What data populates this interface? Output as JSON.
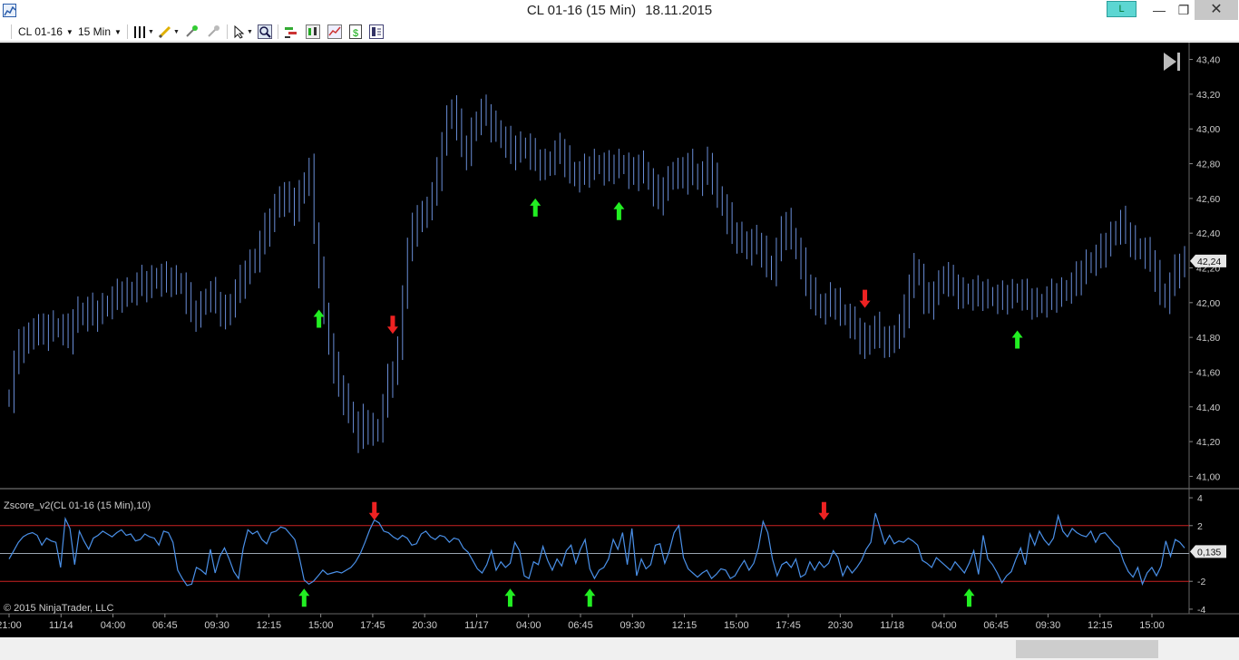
{
  "window": {
    "title": "CL 01-16 (15 Min)",
    "date": "18.11.2015",
    "badge": "L",
    "minimize": "—",
    "restore": "❐",
    "close": "✕"
  },
  "toolbar": {
    "instrument": "CL 01-16",
    "interval": "15 Min",
    "icons": [
      "bar-style-icon",
      "pencil-icon",
      "add-indicator-icon",
      "remove-indicator-icon",
      "cursor-icon",
      "zoom-icon",
      "strategy-icon",
      "candlestick-icon",
      "chart-style-icon",
      "dollar-icon",
      "properties-icon"
    ]
  },
  "colors": {
    "background": "#000000",
    "bars": "#6a8ed8",
    "indicator": "#4a90e8",
    "upper_band": "#cc2222",
    "lower_band": "#cc2222",
    "zero_line": "#9aa4b0",
    "axis_text": "#cccccc",
    "buy_arrow": "#22ee22",
    "sell_arrow": "#ee2222"
  },
  "chart_data": [
    {
      "type": "bar",
      "series": [
        {
          "values": [
            41.45,
            41.65,
            41.75,
            41.8,
            41.78,
            41.86,
            41.84,
            41.82,
            41.87,
            41.85,
            41.86,
            41.84,
            41.8,
            41.9,
            41.95,
            41.92,
            41.96,
            41.93,
            41.95,
            41.97,
            41.99,
            42.02,
            42.04,
            42.06,
            42.05,
            42.07,
            42.1,
            42.12,
            42.1,
            42.13,
            42.15,
            42.12,
            42.14,
            42.13,
            42.12,
            42.1,
            42.02,
            41.95,
            41.93,
            41.98,
            42.03,
            42.05,
            42.0,
            41.96,
            41.92,
            42.0,
            42.06,
            42.12,
            42.18,
            42.22,
            42.26,
            42.34,
            42.42,
            42.48,
            42.54,
            42.62,
            42.58,
            42.6,
            42.54,
            42.62,
            42.7,
            42.76,
            42.4,
            42.18,
            41.95,
            41.75,
            41.62,
            41.52,
            41.45,
            41.38,
            41.3,
            41.22,
            41.32,
            41.28,
            41.25,
            41.28,
            41.4,
            41.55,
            41.6,
            41.72,
            42.05,
            42.3,
            42.42,
            42.5,
            42.48,
            42.56,
            42.62,
            42.74,
            42.92,
            43.05,
            43.12,
            43.02,
            42.9,
            42.86,
            42.98,
            43.05,
            43.1,
            43.08,
            43.02,
            43.0,
            42.94,
            42.92,
            42.86,
            42.9,
            42.88,
            42.9,
            42.85,
            42.82,
            42.8,
            42.78,
            42.82,
            42.86,
            42.88,
            42.82,
            42.76,
            42.72,
            42.74,
            42.76,
            42.78,
            42.8,
            42.79,
            42.76,
            42.78,
            42.79,
            42.8,
            42.79,
            42.74,
            42.74,
            42.79,
            42.76,
            42.7,
            42.64,
            42.6,
            42.66,
            42.7,
            42.76,
            42.74,
            42.72,
            42.8,
            42.75,
            42.7,
            42.74,
            42.8,
            42.72,
            42.62,
            42.55,
            42.48,
            42.4,
            42.38,
            42.36,
            42.3,
            42.35,
            42.34,
            42.3,
            42.22,
            42.18,
            42.3,
            42.4,
            42.46,
            42.38,
            42.3,
            42.22,
            42.1,
            42.06,
            42.0,
            41.96,
            41.98,
            42.02,
            42.0,
            41.94,
            41.92,
            41.88,
            41.85,
            41.8,
            41.75,
            41.82,
            41.85,
            41.8,
            41.78,
            41.76,
            41.82,
            41.86,
            41.95,
            42.1,
            42.2,
            42.15,
            42.02,
            42.0,
            42.06,
            42.1,
            42.16,
            42.12,
            42.1,
            42.06,
            42.04,
            42.06,
            42.04,
            42.06,
            42.05,
            42.04,
            42.03,
            42.02,
            42.03,
            42.04,
            42.05,
            42.06,
            42.04,
            42.02,
            42.0,
            41.99,
            42.0,
            42.02,
            42.04,
            42.05,
            42.06,
            42.08,
            42.1,
            42.14,
            42.18,
            42.22,
            42.24,
            42.26,
            42.3,
            42.34,
            42.38,
            42.42,
            42.46,
            42.4,
            42.36,
            42.32,
            42.3,
            42.28,
            42.24,
            42.16,
            42.06,
            42.02,
            42.1,
            42.18,
            42.22,
            42.24
          ]
        }
      ],
      "ylim": [
        40.95,
        43.45
      ],
      "y_ticks": [
        "43,40",
        "43,20",
        "43,00",
        "42,80",
        "42,60",
        "42,40",
        "42,20",
        "42,00",
        "41,80",
        "41,60",
        "41,40",
        "41,20",
        "41,00"
      ],
      "last_price": "42,24",
      "x_ticks": [
        "21:00",
        "11/14",
        "04:00",
        "06:45",
        "09:30",
        "12:15",
        "15:00",
        "17:45",
        "20:30",
        "11/17",
        "04:00",
        "06:45",
        "09:30",
        "12:15",
        "15:00",
        "17:45",
        "20:30",
        "11/18",
        "04:00",
        "06:45",
        "09:30",
        "12:15",
        "15:00"
      ],
      "signals": [
        {
          "type": "buy",
          "bar": 63
        },
        {
          "type": "sell",
          "bar": 78
        },
        {
          "type": "buy",
          "bar": 107
        },
        {
          "type": "buy",
          "bar": 124
        },
        {
          "type": "sell",
          "bar": 174
        },
        {
          "type": "buy",
          "bar": 205
        }
      ]
    },
    {
      "type": "line",
      "title": "Zscore_v2(CL 01-16 (15 Min),10)",
      "series": [
        {
          "values": [
            -0.4,
            0.2,
            0.8,
            1.2,
            1.4,
            1.5,
            1.3,
            0.6,
            1.1,
            0.9,
            0.8,
            -1.0,
            2.5,
            1.8,
            -0.8,
            1.6,
            0.9,
            0.3,
            1.1,
            1.3,
            1.6,
            1.4,
            1.2,
            1.5,
            1.7,
            1.3,
            1.4,
            0.9,
            1.0,
            1.4,
            1.2,
            1.1,
            0.6,
            1.6,
            1.5,
            0.8,
            -1.2,
            -1.8,
            -2.3,
            -2.2,
            -1.0,
            -1.2,
            -1.5,
            0.3,
            -1.4,
            -0.2,
            0.4,
            -0.4,
            -1.3,
            -1.8,
            0.4,
            1.7,
            1.4,
            1.6,
            1.0,
            0.7,
            1.5,
            1.6,
            1.9,
            1.8,
            1.4,
            1.0,
            -0.3,
            -1.9,
            -2.2,
            -2.0,
            -1.6,
            -1.2,
            -1.5,
            -1.4,
            -1.3,
            -1.4,
            -1.2,
            -1.0,
            -0.6,
            0.0,
            0.8,
            1.7,
            2.4,
            2.2,
            1.6,
            1.5,
            1.2,
            1.0,
            1.3,
            1.1,
            0.6,
            0.7,
            1.4,
            1.6,
            1.2,
            1.0,
            1.3,
            1.2,
            0.8,
            1.1,
            1.0,
            0.4,
            0.1,
            -0.5,
            -1.1,
            -1.4,
            -0.8,
            0.2,
            -1.2,
            -0.6,
            -1.0,
            -0.7,
            0.8,
            0.2,
            -1.6,
            -1.8,
            -0.6,
            -0.8,
            0.5,
            -0.5,
            -1.2,
            -0.4,
            -0.9,
            0.2,
            0.6,
            -0.7,
            0.3,
            1.0,
            -1.1,
            -1.8,
            -1.2,
            -1.0,
            -0.4,
            1.0,
            0.3,
            1.5,
            -0.8,
            1.8,
            -1.6,
            -0.4,
            -1.1,
            -0.8,
            0.6,
            0.7,
            -0.7,
            0.2,
            1.5,
            2.0,
            -0.3,
            -1.1,
            -1.4,
            -1.7,
            -1.4,
            -1.2,
            -1.8,
            -1.5,
            -1.1,
            -1.2,
            -1.8,
            -1.6,
            -1.0,
            -0.5,
            -1.2,
            -0.7,
            0.4,
            2.3,
            1.5,
            -0.4,
            -1.6,
            -0.8,
            -0.6,
            -1.0,
            -0.4,
            -1.7,
            -1.5,
            -0.6,
            -1.2,
            -0.6,
            -1.0,
            -0.7,
            0.2,
            -0.3,
            -1.6,
            -0.9,
            -1.4,
            -1.0,
            -0.5,
            0.3,
            0.8,
            2.9,
            1.8,
            0.7,
            1.3,
            0.7,
            0.9,
            0.8,
            1.1,
            0.9,
            0.6,
            -0.5,
            -0.7,
            -1.0,
            -0.3,
            -0.6,
            -0.9,
            -1.2,
            -0.6,
            -1.0,
            -1.4,
            -0.7,
            0.2,
            -1.5,
            1.3,
            -0.4,
            -0.8,
            -1.4,
            -2.1,
            -1.6,
            -1.3,
            -0.4,
            0.4,
            -0.8,
            1.4,
            0.6,
            1.6,
            1.0,
            0.6,
            1.1,
            2.7,
            1.6,
            1.2,
            1.8,
            1.5,
            1.3,
            1.2,
            1.6,
            0.8,
            1.4,
            1.5,
            1.1,
            0.7,
            0.4,
            -0.6,
            -1.3,
            -1.7,
            -1.0,
            -2.2,
            -1.4,
            -1.0,
            -1.6,
            -0.9,
            0.9,
            -0.2,
            1.0,
            0.8,
            0.4
          ]
        }
      ],
      "ylim": [
        -4.2,
        4.2
      ],
      "y_ticks": [
        "4",
        "2",
        "-2",
        "-4"
      ],
      "levels": [
        2,
        0,
        -2
      ],
      "last_value": "0,135",
      "signals": [
        {
          "type": "sell",
          "point": 78
        },
        {
          "type": "buy",
          "point": 63
        },
        {
          "type": "buy",
          "point": 107
        },
        {
          "type": "buy",
          "point": 124
        },
        {
          "type": "sell",
          "point": 174
        },
        {
          "type": "buy",
          "point": 205
        }
      ]
    }
  ],
  "copyright": "© 2015 NinjaTrader, LLC"
}
